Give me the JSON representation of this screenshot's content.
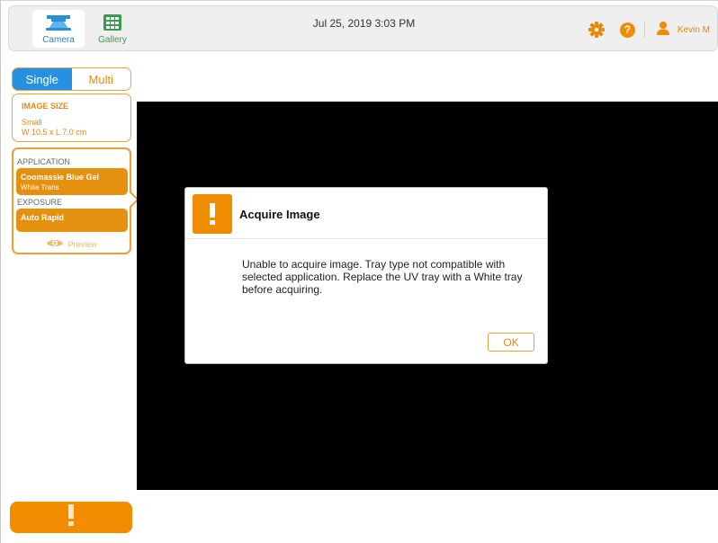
{
  "topbar": {
    "nav": {
      "camera_label": "Camera",
      "gallery_label": "Gallery"
    },
    "datetime": "Jul 25, 2019  3:03 PM",
    "user_name": "Kevin M",
    "icons": [
      "gear-icon",
      "help-icon",
      "user-icon"
    ],
    "help_glyph": "?"
  },
  "sidebar": {
    "mode": {
      "single_label": "Single",
      "multi_label": "Multi",
      "selected": "Single"
    },
    "image_size": {
      "title": "IMAGE SIZE",
      "size_name": "Small",
      "dimensions": "W 10.5 x L 7.0 cm"
    },
    "application": {
      "label": "APPLICATION",
      "name": "Coomassie Blue Gel",
      "sub": "White Trans"
    },
    "exposure": {
      "label": "EXPOSURE",
      "name": "Auto Rapid"
    },
    "preview_label": "Preview"
  },
  "dialog": {
    "title": "Acquire Image",
    "message": "Unable to acquire image. Tray type not compatible with selected application. Replace the UV tray with a White tray before acquiring.",
    "ok_label": "OK"
  },
  "colors": {
    "accent_orange": "#f08c00",
    "select_blue": "#2790e0",
    "gallery_green": "#3a9a50"
  }
}
